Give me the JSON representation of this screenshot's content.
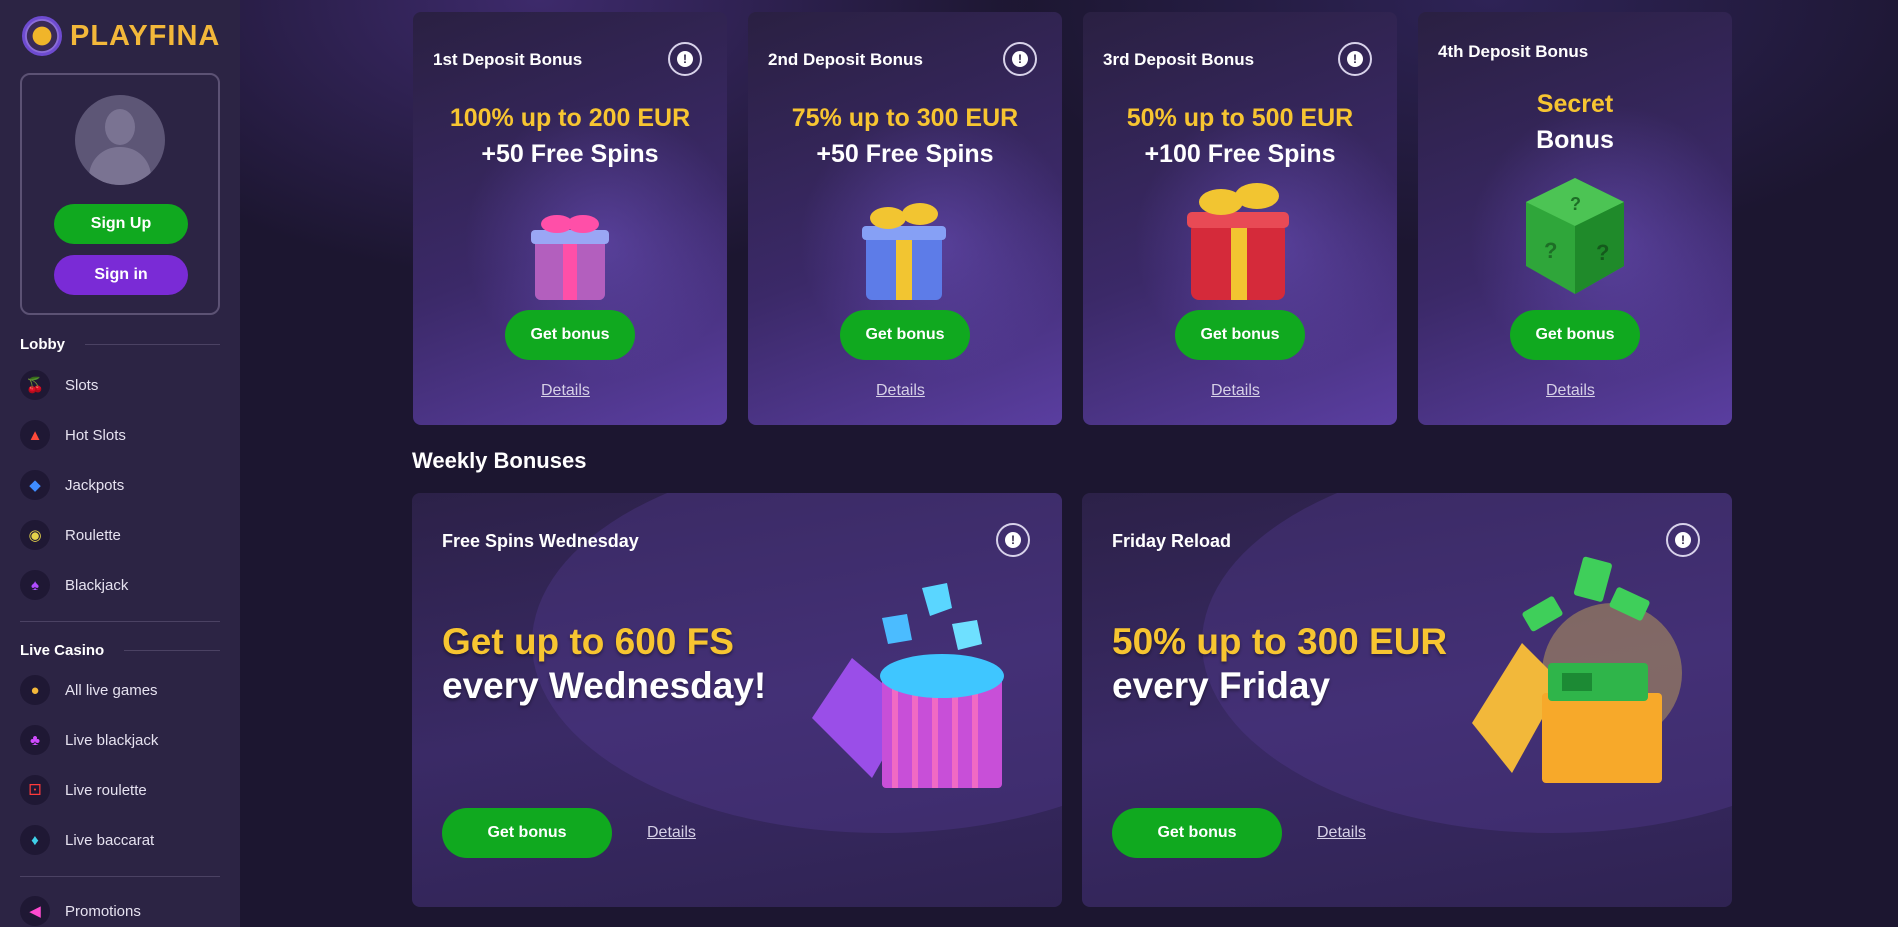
{
  "brand": {
    "name": "PLAYFINA"
  },
  "sidebar": {
    "signup_label": "Sign Up",
    "signin_label": "Sign in",
    "lobby": {
      "title": "Lobby",
      "items": [
        {
          "label": "Slots",
          "icon": "cherry-icon"
        },
        {
          "label": "Hot Slots",
          "icon": "flame-icon"
        },
        {
          "label": "Jackpots",
          "icon": "diamond-icon"
        },
        {
          "label": "Roulette",
          "icon": "roulette-icon"
        },
        {
          "label": "Blackjack",
          "icon": "cards-icon"
        }
      ]
    },
    "live_casino": {
      "title": "Live Casino",
      "items": [
        {
          "label": "All live games",
          "icon": "dealer-icon"
        },
        {
          "label": "Live blackjack",
          "icon": "clubs-icon"
        },
        {
          "label": "Live roulette",
          "icon": "dice-icon"
        },
        {
          "label": "Live baccarat",
          "icon": "baccarat-cards-icon"
        }
      ]
    },
    "promotions_label": "Promotions"
  },
  "deposit_bonuses": [
    {
      "title": "1st Deposit Bonus",
      "highlight": "100% up to 200 EUR",
      "sub": "+50 Free Spins",
      "button": "Get bonus",
      "details": "Details",
      "gift_color": "#e23e9a",
      "ribbon_color": "#ff4fa8"
    },
    {
      "title": "2nd Deposit Bonus",
      "highlight": "75% up to 300 EUR",
      "sub": "+50 Free Spins",
      "button": "Get bonus",
      "details": "Details",
      "gift_color": "#5d7ce8",
      "ribbon_color": "#f2c531"
    },
    {
      "title": "3rd Deposit Bonus",
      "highlight": "50% up to 500 EUR",
      "sub": "+100 Free Spins",
      "button": "Get bonus",
      "details": "Details",
      "gift_color": "#d52a3a",
      "ribbon_color": "#f2c531"
    },
    {
      "title": "4th Deposit Bonus",
      "highlight": "Secret",
      "sub": "Bonus",
      "button": "Get bonus",
      "details": "Details",
      "gift_color": "#2fa63a",
      "ribbon_color": "#1d6e26"
    }
  ],
  "weekly": {
    "title": "Weekly Bonuses",
    "cards": [
      {
        "name": "Free Spins Wednesday",
        "highlight": "Get up to 600 FS",
        "sub": "every Wednesday!",
        "button": "Get bonus",
        "details": "Details"
      },
      {
        "name": "Friday Reload",
        "highlight": "50% up to 300 EUR",
        "sub": "every Friday",
        "button": "Get bonus",
        "details": "Details"
      }
    ]
  }
}
